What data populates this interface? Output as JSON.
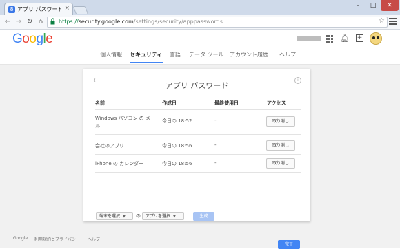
{
  "browser": {
    "tab_title": "アプリ パスワード - アカウント設定",
    "tab_icon": "google-g-icon",
    "url_scheme": "https://",
    "url_host": "security.google.com",
    "url_path": "/settings/security/apppasswords"
  },
  "header": {
    "logo": [
      "G",
      "o",
      "o",
      "g",
      "l",
      "e"
    ],
    "nav": [
      "個人情報",
      "セキュリティ",
      "言語",
      "データ ツール",
      "アカウント履歴",
      "ヘルプ"
    ],
    "active_tab": "セキュリティ"
  },
  "card": {
    "title": "アプリ パスワード",
    "columns": [
      "名前",
      "作成日",
      "最終使用日",
      "アクセス"
    ],
    "rows": [
      {
        "name": "Windows パソコン の メール",
        "created": "今日の 18:52",
        "last_used": "-",
        "action": "取り消し"
      },
      {
        "name": "会社のアプリ",
        "created": "今日の 18:56",
        "last_used": "-",
        "action": "取り消し"
      },
      {
        "name": "iPhone の カレンダー",
        "created": "今日の 18:56",
        "last_used": "-",
        "action": "取り消し"
      }
    ],
    "device_select": "端末を選択",
    "of_label": "の",
    "app_select": "アプリを選択",
    "generate": "生成",
    "done": "完了"
  },
  "footer": [
    "Google",
    "利用規約とプライバシー",
    "ヘルプ"
  ],
  "colors": {
    "accent": "#4285f4",
    "generate_disabled": "#a8c4f4"
  }
}
